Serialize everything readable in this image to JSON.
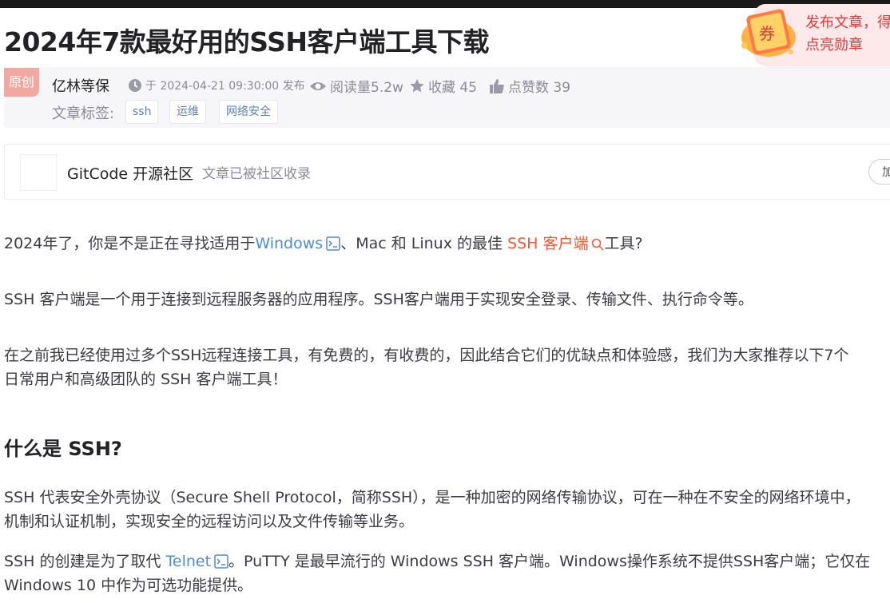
{
  "title": "2024年7款最好用的SSH客户端工具下载",
  "promo": {
    "line1": "发布文章，得",
    "line2": "点亮勋章",
    "coupon_char": "券"
  },
  "meta": {
    "badge": "原创",
    "author": "亿林等保",
    "publish": "于 2024-04-21 09:30:00 发布",
    "views": "阅读量5.2w",
    "favorites": "收藏 45",
    "likes": "点赞数 39",
    "tags_label": "文章标签:",
    "tags": [
      "ssh",
      "运维",
      "网络安全"
    ]
  },
  "community": {
    "name": "GitCode 开源社区",
    "note": "文章已被社区收录",
    "button": "加"
  },
  "article": {
    "p1_a": "2024年了，你是不是正在寻找适用于",
    "p1_link": "Windows",
    "p1_b": "、Mac 和 Linux 的最佳 ",
    "p1_red": "SSH 客户端",
    "p1_c": "工具?",
    "p2": "SSH 客户端是一个用于连接到远程服务器的应用程序。SSH客户端用于实现安全登录、传输文件、执行命令等。",
    "p3_l1": "在之前我已经使用过多个SSH远程连接工具，有免费的，有收费的，因此结合它们的优缺点和体验感，我们为大家推荐以下7个",
    "p3_l2": "日常用户和高级团队的 SSH 客户端工具！",
    "h2": "什么是 SSH?",
    "p4_l1": "SSH 代表安全外壳协议（Secure Shell Protocol，简称SSH），是一种加密的网络传输协议，可在一种在不安全的网络环境中，",
    "p4_l2": "机制和认证机制，实现安全的远程访问以及文件传输等业务。",
    "p5_a": "SSH 的创建是为了取代 ",
    "p5_link": "Telnet",
    "p5_b": "。PuTTY 是最早流行的 Windows SSH 客户端。Windows操作系统不提供SSH客户端；它仅在",
    "p5_l2": "Windows 10 中作为可选功能提供。"
  },
  "colors": {
    "link": "#4e8ccd",
    "highlight": "#fc5531",
    "promo_text": "#e03b3b"
  }
}
